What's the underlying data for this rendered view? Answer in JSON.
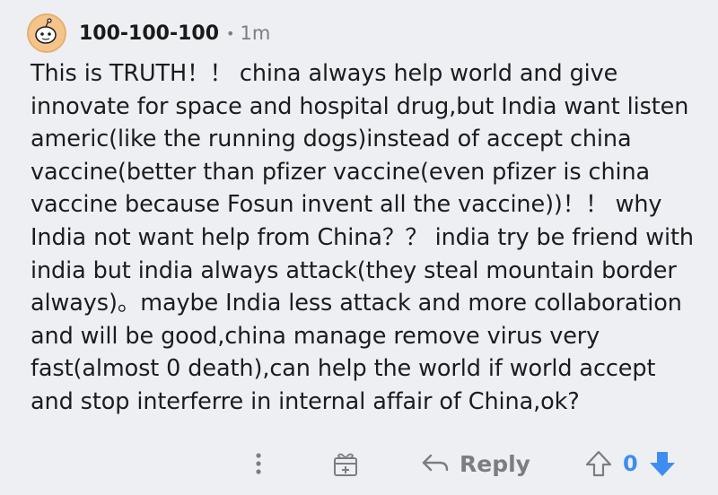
{
  "comment": {
    "username": "100-100-100",
    "separator": "•",
    "time": "1m",
    "body": "This is TRUTH！！ china always help world and give\ninnovate for space and hospital drug,but India want listen\nameric(like the running dogs)instead of accept china\nvaccine(better than pfizer vaccine(even pfizer is china\nvaccine because Fosun invent all the vaccine))！！ why\nIndia not want help from China？？ india try be friend with\nindia but india always attack(they steal mountain border\nalways)。maybe India less attack and more collaboration\nand will be good,china manage remove virus very\nfast(almost 0 death),can help the world if world accept\nand stop interferre in internal affair of China,ok?"
  },
  "actions": {
    "more_icon": "more-vertical-icon",
    "award_icon": "gift-icon",
    "reply_icon": "reply-arrow-icon",
    "reply_label": "Reply",
    "upvote_icon": "upvote-arrow-icon",
    "score": "0",
    "downvote_icon": "downvote-arrow-icon"
  },
  "colors": {
    "background": "#eeeff3",
    "text": "#1c1c1e",
    "meta": "#7c7c83",
    "accent_blue": "#3d8ef0"
  }
}
